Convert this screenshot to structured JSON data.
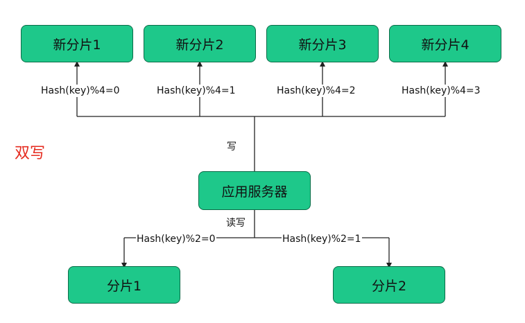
{
  "diagram": {
    "side_label": "双写",
    "new_shards": [
      {
        "label": "新分片1",
        "rule": "Hash(key)%4=0"
      },
      {
        "label": "新分片2",
        "rule": "Hash(key)%4=1"
      },
      {
        "label": "新分片3",
        "rule": "Hash(key)%4=2"
      },
      {
        "label": "新分片4",
        "rule": "Hash(key)%4=3"
      }
    ],
    "write_label": "写",
    "server": {
      "label": "应用服务器"
    },
    "read_write_label": "读写",
    "old_shards": [
      {
        "label": "分片1",
        "rule": "Hash(key)%2=0"
      },
      {
        "label": "分片2",
        "rule": "Hash(key)%2=1"
      }
    ],
    "colors": {
      "node_fill": "#1ec88a",
      "node_border": "#0a6b47",
      "accent_text": "#e52b1f"
    }
  }
}
